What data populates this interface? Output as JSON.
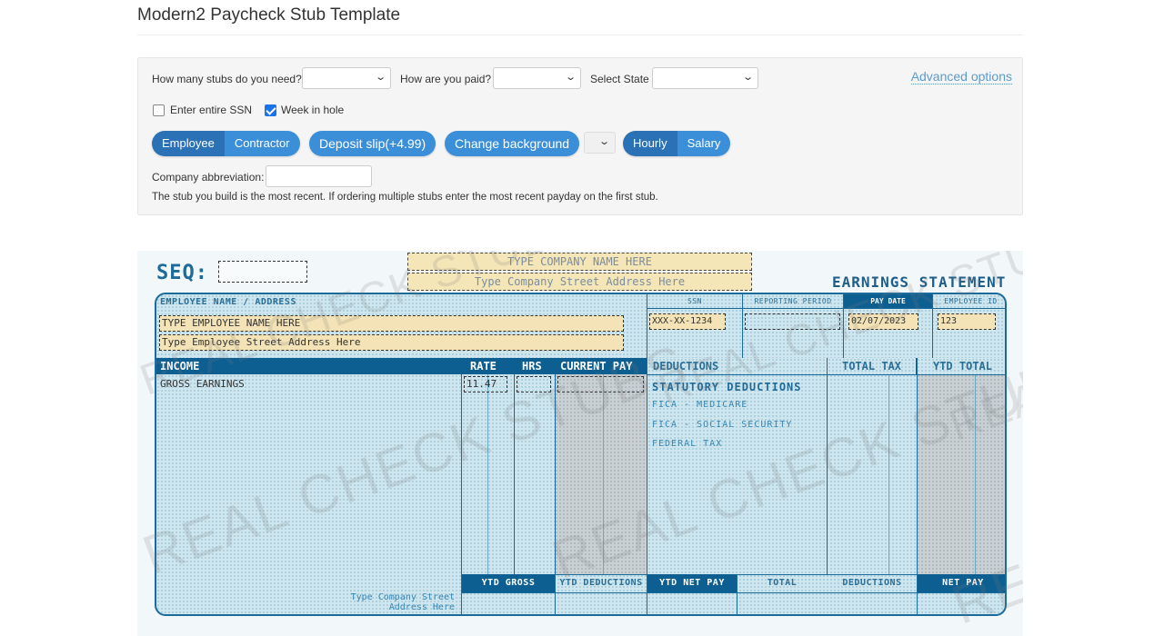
{
  "page": {
    "title": "Modern2 Paycheck Stub Template"
  },
  "options": {
    "stubs_label": "How many stubs do you need?",
    "stubs_value": "",
    "paid_label": "How are you paid?",
    "paid_value": "",
    "state_label": "Select State",
    "state_value": "",
    "advanced_link": "Advanced options",
    "ssn_checkbox_label": "Enter entire SSN",
    "ssn_checked": false,
    "week_hole_label": "Week in hole",
    "week_hole_checked": true,
    "worker_type": {
      "options": [
        "Employee",
        "Contractor"
      ],
      "selected": "Employee"
    },
    "deposit_slip_button": "Deposit slip(+4.99)",
    "change_background_button": "Change background",
    "background_select_value": "",
    "pay_type": {
      "options": [
        "Hourly",
        "Salary"
      ],
      "selected": "Hourly"
    },
    "company_abbrev_label": "Company abbreviation:",
    "company_abbrev_value": "",
    "note": "The stub you build is the most recent. If ordering multiple stubs enter the most recent payday on the first stub."
  },
  "stub": {
    "seq_label": "SEQ:",
    "seq_value": "",
    "company_name_placeholder": "TYPE COMPANY NAME HERE",
    "company_address_placeholder": "Type Company Street Address Here",
    "statement_title": "EARNINGS STATEMENT",
    "employee_section_label": "EMPLOYEE NAME / ADDRESS",
    "employee_name": "TYPE EMPLOYEE NAME HERE",
    "employee_address": "Type Employee Street Address Here",
    "headers": {
      "ssn": "SSN",
      "reporting_period": "REPORTING PERIOD",
      "pay_date": "PAY DATE",
      "employee_id": "EMPLOYEE ID"
    },
    "values": {
      "ssn": "XXX-XX-1234",
      "reporting_period": "",
      "pay_date": "02/07/2023",
      "employee_id": "123"
    },
    "income_headers": {
      "income": "INCOME",
      "rate": "RATE",
      "hrs": "HRS",
      "current_pay": "CURRENT PAY"
    },
    "income_rows": [
      {
        "label": "GROSS EARNINGS",
        "rate": "11.47",
        "hrs": "",
        "current_pay": ""
      }
    ],
    "deduction_headers": {
      "deductions": "DEDUCTIONS",
      "total_tax": "TOTAL TAX",
      "ytd_total": "YTD TOTAL"
    },
    "deductions_title": "STATUTORY DEDUCTIONS",
    "deduction_items": [
      "FICA - MEDICARE",
      "FICA - SOCIAL SECURITY",
      "FEDERAL TAX"
    ],
    "footer": {
      "ytd_gross": "YTD GROSS",
      "ytd_deductions": "YTD DEDUCTIONS",
      "ytd_net_pay": "YTD NET PAY",
      "total": "TOTAL",
      "deductions": "DEDUCTIONS",
      "net_pay": "NET PAY",
      "company_address_line1": "Type Company Street",
      "company_address_line2": "Address Here"
    },
    "watermark": "REAL CHECK STUBS"
  }
}
